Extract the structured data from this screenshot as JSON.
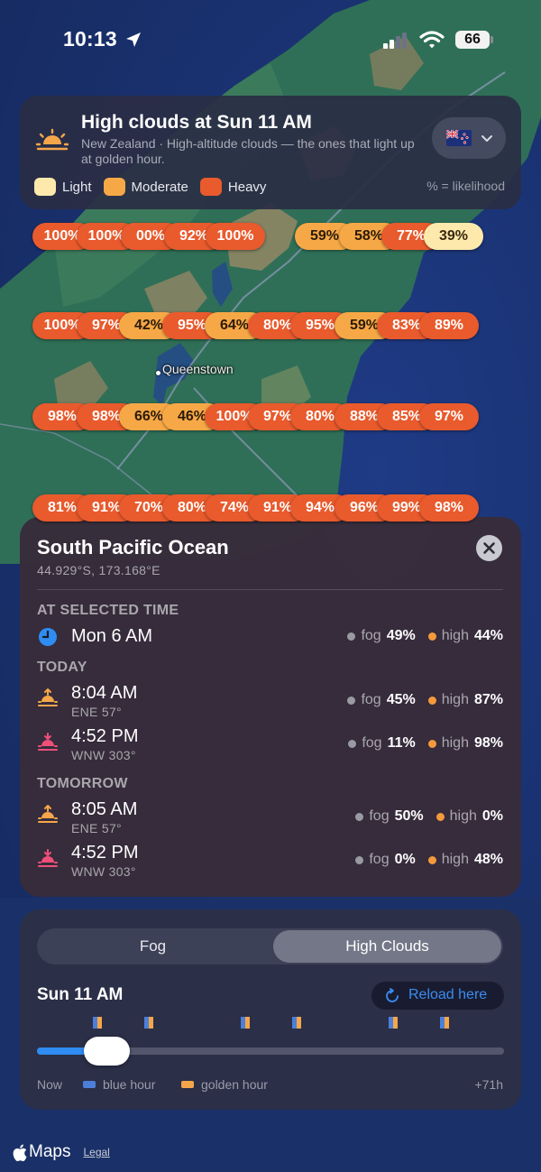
{
  "status_bar": {
    "time": "10:13",
    "battery": "66"
  },
  "legend_card": {
    "title": "High clouds at Sun 11 AM",
    "subtitle": "New Zealand · High-altitude clouds — the ones that light up at golden hour.",
    "legend": [
      {
        "label": "Light",
        "color": "#fde9ac"
      },
      {
        "label": "Moderate",
        "color": "#f7a846"
      },
      {
        "label": "Heavy",
        "color": "#e95a2c"
      }
    ],
    "likelihood_note": "% = likelihood",
    "region_flag": "new-zealand-flag-icon"
  },
  "map": {
    "place_label": "Queenstown",
    "pill_rows": [
      [
        {
          "text": "100%",
          "level": "heavy"
        },
        {
          "text": "100%",
          "level": "heavy"
        },
        {
          "text": "00%",
          "level": "heavy"
        },
        {
          "text": "92%",
          "level": "heavy"
        },
        {
          "text": "100%",
          "level": "heavy"
        },
        {
          "text": "59%",
          "level": "moderate"
        },
        {
          "text": "58%",
          "level": "moderate"
        },
        {
          "text": "77%",
          "level": "heavy"
        },
        {
          "text": "39%",
          "level": "light"
        }
      ],
      [
        {
          "text": "100%",
          "level": "heavy"
        },
        {
          "text": "97%",
          "level": "heavy"
        },
        {
          "text": "42%",
          "level": "moderate"
        },
        {
          "text": "95%",
          "level": "heavy"
        },
        {
          "text": "64%",
          "level": "moderate"
        },
        {
          "text": "80%",
          "level": "heavy"
        },
        {
          "text": "95%",
          "level": "heavy"
        },
        {
          "text": "59%",
          "level": "moderate"
        },
        {
          "text": "83%",
          "level": "heavy"
        },
        {
          "text": "89%",
          "level": "heavy"
        }
      ],
      [
        {
          "text": "98%",
          "level": "heavy"
        },
        {
          "text": "98%",
          "level": "heavy"
        },
        {
          "text": "66%",
          "level": "moderate"
        },
        {
          "text": "46%",
          "level": "moderate"
        },
        {
          "text": "100%",
          "level": "heavy"
        },
        {
          "text": "97%",
          "level": "heavy"
        },
        {
          "text": "80%",
          "level": "heavy"
        },
        {
          "text": "88%",
          "level": "heavy"
        },
        {
          "text": "85%",
          "level": "heavy"
        },
        {
          "text": "97%",
          "level": "heavy"
        }
      ],
      [
        {
          "text": "81%",
          "level": "heavy"
        },
        {
          "text": "91%",
          "level": "heavy"
        },
        {
          "text": "70%",
          "level": "heavy"
        },
        {
          "text": "80%",
          "level": "heavy"
        },
        {
          "text": "74%",
          "level": "heavy"
        },
        {
          "text": "91%",
          "level": "heavy"
        },
        {
          "text": "94%",
          "level": "heavy"
        },
        {
          "text": "96%",
          "level": "heavy"
        },
        {
          "text": "99%",
          "level": "heavy"
        },
        {
          "text": "98%",
          "level": "heavy"
        }
      ]
    ]
  },
  "detail": {
    "location": "South Pacific Ocean",
    "coords": "44.929°S, 173.168°E",
    "selected_header": "AT SELECTED TIME",
    "selected": {
      "time": "Mon 6 AM",
      "fog_label": "fog",
      "fog": "49%",
      "high_label": "high",
      "high": "44%"
    },
    "today_header": "TODAY",
    "today": [
      {
        "kind": "sunrise",
        "time": "8:04 AM",
        "dir": "ENE 57°",
        "fog_label": "fog",
        "fog": "45%",
        "high_label": "high",
        "high": "87%"
      },
      {
        "kind": "sunset",
        "time": "4:52 PM",
        "dir": "WNW 303°",
        "fog_label": "fog",
        "fog": "11%",
        "high_label": "high",
        "high": "98%"
      }
    ],
    "tomorrow_header": "TOMORROW",
    "tomorrow": [
      {
        "kind": "sunrise",
        "time": "8:05 AM",
        "dir": "ENE 57°",
        "fog_label": "fog",
        "fog": "50%",
        "high_label": "high",
        "high": "0%"
      },
      {
        "kind": "sunset",
        "time": "4:52 PM",
        "dir": "WNW 303°",
        "fog_label": "fog",
        "fog": "0%",
        "high_label": "high",
        "high": "48%"
      }
    ]
  },
  "controls": {
    "segments": [
      "Fog",
      "High Clouds"
    ],
    "selected_segment": "High Clouds",
    "selected_time": "Sun 11 AM",
    "reload_label": "Reload here",
    "slider_value_fraction": 0.11,
    "scale_start": "Now",
    "scale_end": "+71h",
    "legend_blue": "blue hour",
    "legend_golden": "golden hour",
    "blue_color": "#4c7fd9",
    "golden_color": "#f5a64a"
  },
  "attribution": {
    "brand": "Maps",
    "legal": "Legal"
  }
}
